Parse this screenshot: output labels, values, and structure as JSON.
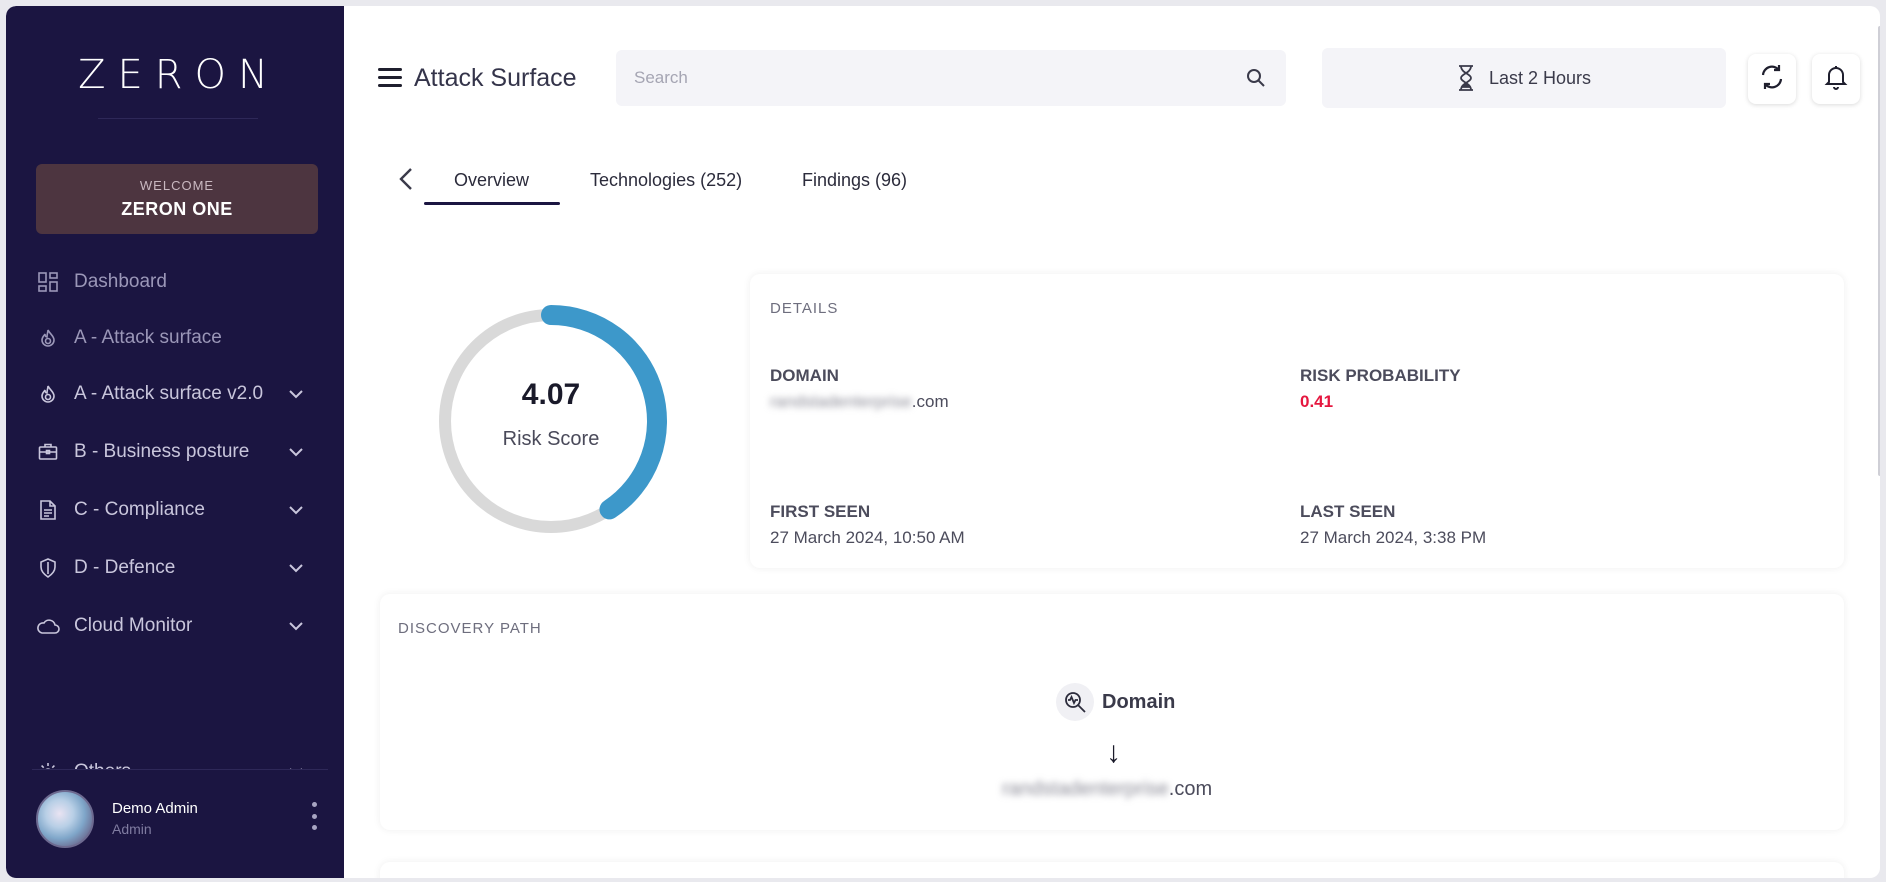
{
  "sidebar": {
    "logo": "ZERON",
    "welcome_label": "WELCOME",
    "welcome_name": "ZERON ONE",
    "items": [
      {
        "label": "Dashboard",
        "icon": "grid-icon",
        "has_submenu": false
      },
      {
        "label": "A - Attack surface",
        "icon": "flame-icon",
        "has_submenu": false
      },
      {
        "label": "A - Attack surface v2.0",
        "icon": "flame-icon",
        "has_submenu": true
      },
      {
        "label": "B - Business posture",
        "icon": "briefcase-icon",
        "has_submenu": true
      },
      {
        "label": "C - Compliance",
        "icon": "document-icon",
        "has_submenu": true
      },
      {
        "label": "D - Defence",
        "icon": "shield-icon",
        "has_submenu": true
      },
      {
        "label": "Cloud Monitor",
        "icon": "cloud-icon",
        "has_submenu": true
      },
      {
        "label": "Others",
        "icon": "gear-icon",
        "has_submenu": true
      }
    ],
    "user": {
      "name": "Demo Admin",
      "role": "Admin"
    }
  },
  "header": {
    "title": "Attack Surface",
    "search_placeholder": "Search",
    "time_range": "Last 2 Hours"
  },
  "tabs": [
    {
      "label": "Overview",
      "active": true
    },
    {
      "label": "Technologies (252)",
      "active": false
    },
    {
      "label": "Findings (96)",
      "active": false
    }
  ],
  "risk": {
    "score": "4.07",
    "score_value": 4.07,
    "score_max": 10,
    "label": "Risk Score",
    "gauge_color": "#3d98ca",
    "track_color": "#d9d9d9"
  },
  "details": {
    "title": "DETAILS",
    "domain_label": "DOMAIN",
    "domain_hidden": "randstadenterprise",
    "domain_suffix": ".com",
    "risk_prob_label": "RISK PROBABILITY",
    "risk_prob_value": "0.41",
    "first_seen_label": "FIRST SEEN",
    "first_seen_value": "27 March 2024, 10:50 AM",
    "last_seen_label": "LAST SEEN",
    "last_seen_value": "27 March 2024, 3:38 PM"
  },
  "discovery": {
    "title": "DISCOVERY PATH",
    "node_label": "Domain",
    "arrow": "↓",
    "domain_hidden": "randstadenterprise",
    "domain_suffix": ".com"
  },
  "colors": {
    "sidebar_bg": "#1b1541",
    "accent": "#3d98ca",
    "risk": "#e5173f"
  }
}
